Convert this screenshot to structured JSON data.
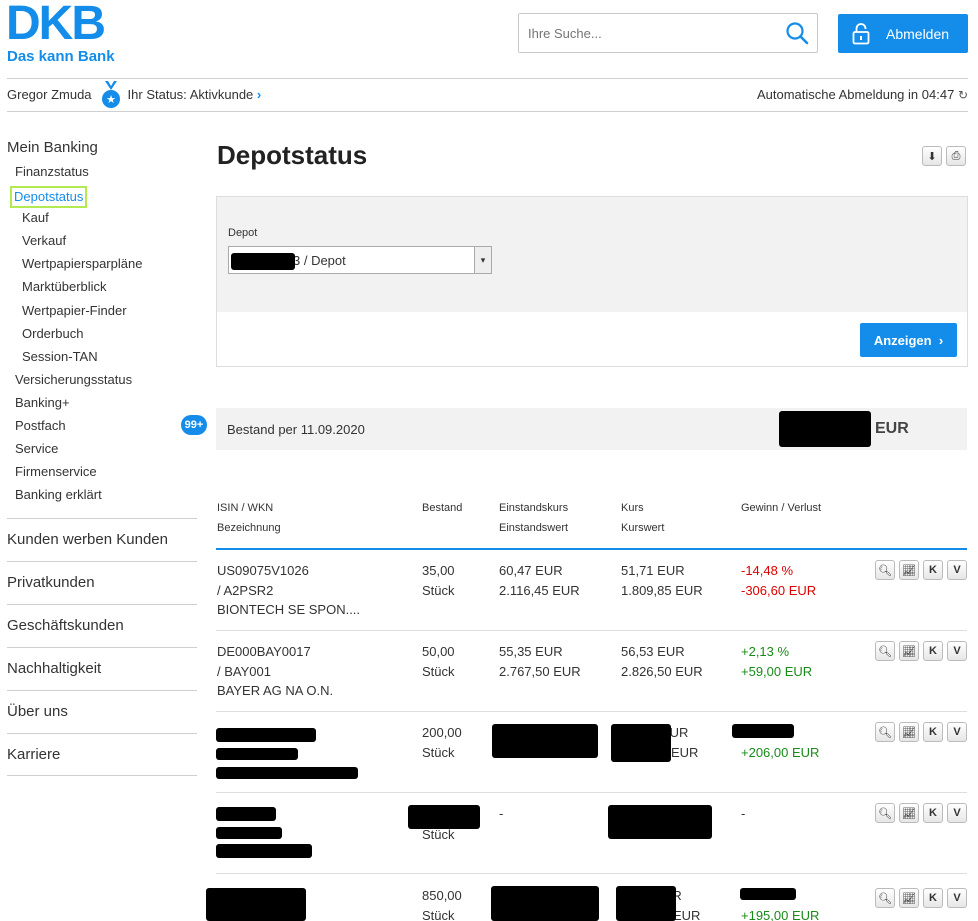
{
  "brand": {
    "name": "DKB",
    "slogan": "Das kann Bank"
  },
  "search": {
    "placeholder": "Ihre Suche..."
  },
  "logout_label": "Abmelden",
  "user": {
    "name": "Gregor Zmuda",
    "status": "Ihr Status: Aktivkunde",
    "logout_timer_label": "Automatische Abmeldung in",
    "logout_timer": "04:47"
  },
  "sidebar": {
    "section": "Mein Banking",
    "items": [
      {
        "label": "Finanzstatus"
      },
      {
        "label": "Depotstatus",
        "active": true
      },
      {
        "label": "Kauf"
      },
      {
        "label": "Verkauf"
      },
      {
        "label": "Wertpapiersparpläne"
      },
      {
        "label": "Marktüberblick"
      },
      {
        "label": "Wertpapier-Finder"
      },
      {
        "label": "Orderbuch"
      },
      {
        "label": "Session-TAN"
      },
      {
        "label": "Versicherungsstatus"
      },
      {
        "label": "Banking+"
      },
      {
        "label": "Postfach",
        "badge": "99+"
      },
      {
        "label": "Service"
      },
      {
        "label": "Firmenservice"
      },
      {
        "label": "Banking erklärt"
      }
    ],
    "top_sections": [
      "Kunden werben Kunden",
      "Privatkunden",
      "Geschäftskunden",
      "Nachhaltigkeit",
      "Über uns",
      "Karriere"
    ]
  },
  "page": {
    "title": "Depotstatus",
    "depot_label": "Depot",
    "depot_value": "3 / Depot",
    "show_button": "Anzeigen",
    "bestand_label": "Bestand per 11.09.2020",
    "bestand_currency": "EUR"
  },
  "table": {
    "headers": {
      "isin": "ISIN / WKN",
      "bezeichnung": "Bezeichnung",
      "bestand": "Bestand",
      "einstandskurs": "Einstandskurs",
      "einstandswert": "Einstandswert",
      "kurs": "Kurs",
      "kurswert": "Kurswert",
      "gewinn": "Gewinn / Verlust"
    },
    "rows": [
      {
        "isin": "US09075V1026",
        "wkn": "/ A2PSR2",
        "name": "BIONTECH SE SPON....",
        "qty": "35,00",
        "unit": "Stück",
        "ek": "60,47 EUR",
        "ew": "2.116,45 EUR",
        "kurs": "51,71 EUR",
        "kw": "1.809,85 EUR",
        "pct": "-14,48 %",
        "abs": "-306,60 EUR"
      },
      {
        "isin": "DE000BAY0017",
        "wkn": "/ BAY001",
        "name": "BAYER AG NA O.N.",
        "qty": "50,00",
        "unit": "Stück",
        "ek": "55,35 EUR",
        "ew": "2.767,50 EUR",
        "kurs": "56,53 EUR",
        "kw": "2.826,50 EUR",
        "pct": "+2,13 %",
        "abs": "+59,00 EUR"
      },
      {
        "qty": "200,00",
        "unit": "Stück",
        "kurs_frag": "EUR",
        "kw_frag": "EUR",
        "abs": "+206,00 EUR"
      },
      {
        "unit": "Stück",
        "ek": "-",
        "pct": "-"
      },
      {
        "qty": "850,00",
        "unit": "Stück",
        "kurs_frag": "UR",
        "kw_frag": "EUR",
        "abs": "+195,00 EUR"
      }
    ],
    "action_icons": [
      "search-icon",
      "chart-icon",
      "buy-icon",
      "sell-icon"
    ],
    "action_labels": {
      "buy": "K",
      "sell": "V"
    }
  },
  "colors": {
    "accent": "#148dea",
    "negative": "#e00000",
    "positive": "#1a8a1a",
    "highlight": "#b3ea51"
  }
}
